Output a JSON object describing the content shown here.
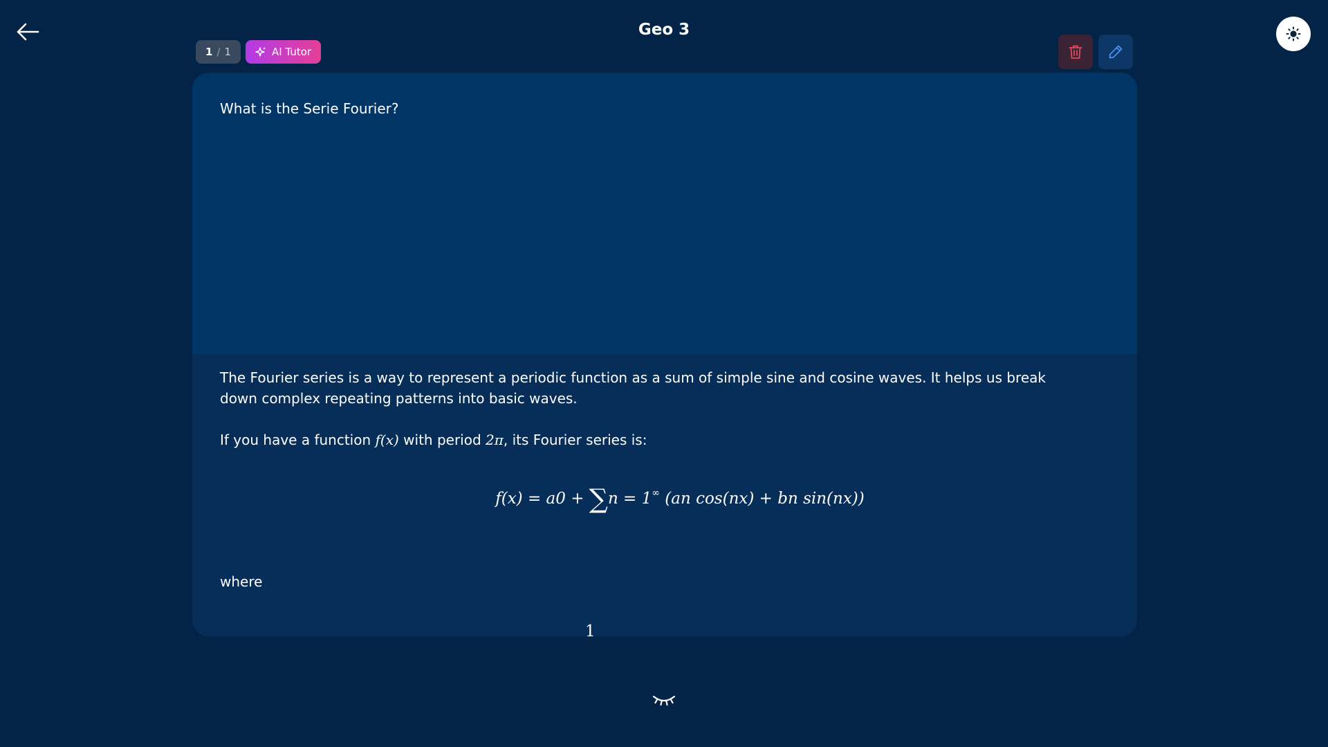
{
  "deck": {
    "title": "Geo 3"
  },
  "counter": {
    "current": "1",
    "separator": "/",
    "total": "1"
  },
  "ai_tutor": {
    "label": "AI Tutor"
  },
  "card": {
    "question": "What is the Serie Fourier?",
    "answer": {
      "intro": "The Fourier series is a way to represent a periodic function as a sum of simple sine and cosine waves. It helps us break down complex repeating patterns into basic waves.",
      "sentence_before": "If you have a function ",
      "function_symbol": "f(x)",
      "sentence_middle": " with period ",
      "period_symbol": "2π",
      "sentence_after": ", its Fourier series is:",
      "formula_left": "f(x) = a0 + ",
      "formula_sum": "∑",
      "formula_index": "n = 1",
      "formula_sup": "∞",
      "formula_right": " (an cos(nx) + bn sin(nx))",
      "where": "where",
      "partial_formula_fraction": "1"
    }
  },
  "icons": {
    "back": "arrow-left-icon",
    "theme": "sun-icon",
    "ai": "sparkles-icon",
    "delete": "trash-icon",
    "edit": "pencil-icon",
    "reveal": "eye-closed-icon"
  },
  "colors": {
    "background": "#032447",
    "card_front": "#013566",
    "card_back": "#062e58",
    "ai_gradient_start": "#b23be6",
    "ai_gradient_end": "#e43f97",
    "delete_bg": "#3a2334",
    "delete_icon": "#e04a5a",
    "edit_bg": "#0c3767",
    "edit_icon": "#4f8ff0"
  }
}
